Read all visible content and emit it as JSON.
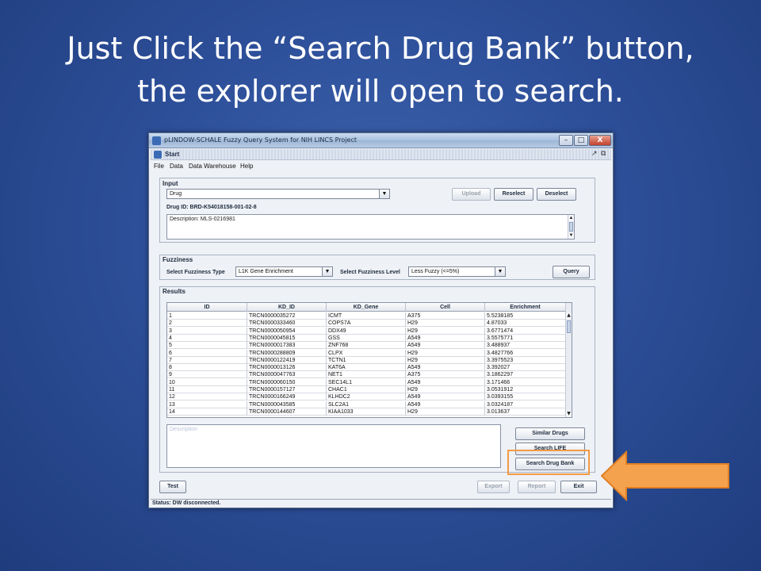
{
  "slide": {
    "title_line1": "Just Click the “Search Drug Bank” button,",
    "title_line2": "the explorer will open to search."
  },
  "window": {
    "title": "pLINDOW-SCHALE Fuzzy Query System for NIH LINCS Project",
    "controls": [
      "–",
      "□",
      "X"
    ]
  },
  "internal_frame": {
    "title": "Start"
  },
  "menu": [
    "File",
    "Data",
    "Data Warehouse",
    "Help"
  ],
  "input_panel": {
    "title": "Input",
    "type_value": "Drug",
    "upload_label": "Upload",
    "reselect_label": "Reselect",
    "deselect_label": "Deselect",
    "drug_id": "Drug ID: BRD-K54018158-001-02-8",
    "description": "Description:  MLS-0216981"
  },
  "fuzziness_panel": {
    "title": "Fuzziness",
    "type_label": "Select Fuzziness Type",
    "type_value": "L1K Gene Enrichment",
    "level_label": "Select Fuzziness Level",
    "level_value": "Less Fuzzy (<=5%)",
    "query_label": "Query"
  },
  "results_panel": {
    "title": "Results",
    "columns": [
      "ID",
      "KD_ID",
      "KD_Gene",
      "Cell",
      "Enrichment"
    ],
    "rows": [
      [
        "1",
        "TRCN0000035272",
        "ICMT",
        "A375",
        "5.5238185"
      ],
      [
        "2",
        "TRCN0000333460",
        "COPS7A",
        "H29",
        "4.87033"
      ],
      [
        "3",
        "TRCN0000050954",
        "DDX49",
        "H29",
        "3.6771474"
      ],
      [
        "4",
        "TRCN0000045815",
        "GSS",
        "A549",
        "3.5575771"
      ],
      [
        "5",
        "TRCN0000017383",
        "ZNF768",
        "A549",
        "3.488937"
      ],
      [
        "6",
        "TRCN0000288809",
        "CLPX",
        "H29",
        "3.4827766"
      ],
      [
        "7",
        "TRCN0000122419",
        "TCTN1",
        "H29",
        "3.3975523"
      ],
      [
        "8",
        "TRCN0000013126",
        "KAT6A",
        "A549",
        "3.392027"
      ],
      [
        "9",
        "TRCN0000047763",
        "NET1",
        "A375",
        "3.1862297"
      ],
      [
        "10",
        "TRCN0000060150",
        "SEC14L1",
        "A549",
        "3.171466"
      ],
      [
        "11",
        "TRCN0000157127",
        "CHAC1",
        "H29",
        "3.0531912"
      ],
      [
        "12",
        "TRCN0000166249",
        "KLHDC2",
        "A549",
        "3.0393155"
      ],
      [
        "13",
        "TRCN0000043585",
        "SLC2A1",
        "A549",
        "3.0324187"
      ],
      [
        "14",
        "TRCN0000144607",
        "KIAA1033",
        "H29",
        "3.013637"
      ]
    ],
    "description_placeholder": "Description",
    "similar_drugs_label": "Similar Drugs",
    "search_life_label": "Search LIFE",
    "search_drugbank_label": "Search Drug Bank"
  },
  "bottom_buttons": {
    "test_label": "Test",
    "export_label": "Export",
    "report_label": "Report",
    "exit_label": "Exit"
  },
  "status": "Status: DW disconnected.",
  "colors": {
    "background": "#2d4f99",
    "highlight": "#f39a45",
    "arrow_fill": "#f5a24f"
  }
}
